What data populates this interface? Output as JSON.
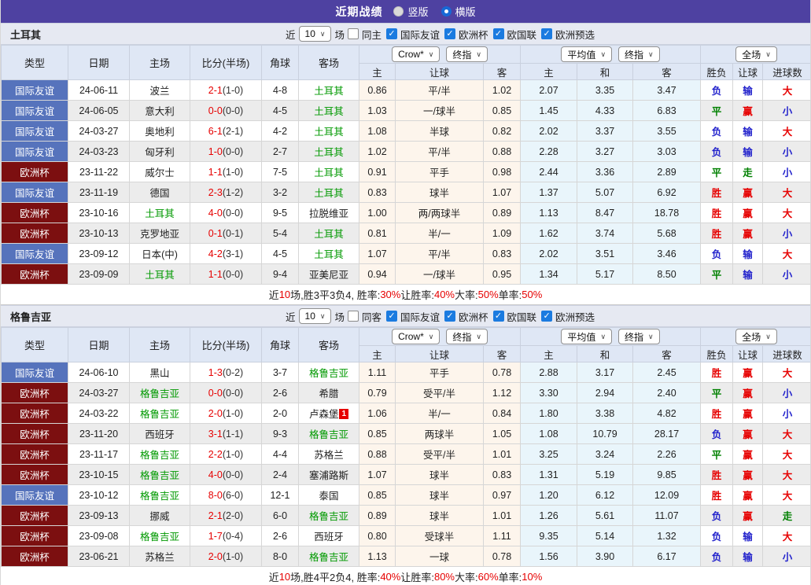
{
  "topbar": {
    "title": "近期战绩",
    "vertical": "竖版",
    "horizontal": "横版",
    "selected": "横版"
  },
  "filters": {
    "near": "近",
    "count": "10",
    "games": "场",
    "leagues": [
      "国际友谊",
      "欧洲杯",
      "欧国联",
      "欧洲预选"
    ]
  },
  "table_head": {
    "left": [
      "类型",
      "日期",
      "主场",
      "比分(半场)",
      "角球",
      "客场"
    ],
    "crow_select": "Crow*",
    "final_select": "终指",
    "avg_select": "平均值",
    "full_select": "全场",
    "crow_cols": [
      "主",
      "让球",
      "客"
    ],
    "avg_cols": [
      "主",
      "和",
      "客"
    ],
    "full_cols": [
      "胜负",
      "让球",
      "进球数"
    ]
  },
  "colors": {
    "accent_purple": "#4e41a1",
    "win_red": "#e60000",
    "lose_blue": "#2323cc",
    "draw_green": "#008000",
    "team_green": "#009900",
    "friendly_blue": "#5673bc",
    "eurocup_maroon": "#7c0f10",
    "crow_bg": "#fdf5ec",
    "avg_bg": "#e9f5fb"
  },
  "sections": [
    {
      "team": "土耳其",
      "same_label": "同主",
      "rows": [
        {
          "type": "国际友谊",
          "type_color": "blue",
          "date": "24-06-11",
          "home": "波兰",
          "home_highlight": false,
          "score": "2-1",
          "half": "(1-0)",
          "corner": "4-8",
          "away": "土耳其",
          "away_highlight": true,
          "crow_home": "0.86",
          "handicap": "平/半",
          "crow_away": "1.02",
          "avg_home": "2.07",
          "avg_draw": "3.35",
          "avg_away": "3.47",
          "result": "负",
          "result_color": "blue",
          "let_result": "输",
          "let_color": "blue",
          "goal": "大",
          "goal_color": "red"
        },
        {
          "type": "国际友谊",
          "type_color": "blue",
          "date": "24-06-05",
          "home": "意大利",
          "home_highlight": false,
          "score": "0-0",
          "half": "(0-0)",
          "corner": "4-5",
          "away": "土耳其",
          "away_highlight": true,
          "crow_home": "1.03",
          "handicap": "一/球半",
          "crow_away": "0.85",
          "avg_home": "1.45",
          "avg_draw": "4.33",
          "avg_away": "6.83",
          "result": "平",
          "result_color": "green",
          "let_result": "赢",
          "let_color": "red",
          "goal": "小",
          "goal_color": "blue"
        },
        {
          "type": "国际友谊",
          "type_color": "blue",
          "date": "24-03-27",
          "home": "奥地利",
          "home_highlight": false,
          "score": "6-1",
          "half": "(2-1)",
          "corner": "4-2",
          "away": "土耳其",
          "away_highlight": true,
          "crow_home": "1.08",
          "handicap": "半球",
          "crow_away": "0.82",
          "avg_home": "2.02",
          "avg_draw": "3.37",
          "avg_away": "3.55",
          "result": "负",
          "result_color": "blue",
          "let_result": "输",
          "let_color": "blue",
          "goal": "大",
          "goal_color": "red"
        },
        {
          "type": "国际友谊",
          "type_color": "blue",
          "date": "24-03-23",
          "home": "匈牙利",
          "home_highlight": false,
          "score": "1-0",
          "half": "(0-0)",
          "corner": "2-7",
          "away": "土耳其",
          "away_highlight": true,
          "crow_home": "1.02",
          "handicap": "平/半",
          "crow_away": "0.88",
          "avg_home": "2.28",
          "avg_draw": "3.27",
          "avg_away": "3.03",
          "result": "负",
          "result_color": "blue",
          "let_result": "输",
          "let_color": "blue",
          "goal": "小",
          "goal_color": "blue"
        },
        {
          "type": "欧洲杯",
          "type_color": "maroon",
          "date": "23-11-22",
          "home": "威尔士",
          "home_highlight": false,
          "score": "1-1",
          "half": "(1-0)",
          "corner": "7-5",
          "away": "土耳其",
          "away_highlight": true,
          "crow_home": "0.91",
          "handicap": "平手",
          "crow_away": "0.98",
          "avg_home": "2.44",
          "avg_draw": "3.36",
          "avg_away": "2.89",
          "result": "平",
          "result_color": "green",
          "let_result": "走",
          "let_color": "green",
          "goal": "小",
          "goal_color": "blue"
        },
        {
          "type": "国际友谊",
          "type_color": "blue",
          "date": "23-11-19",
          "home": "德国",
          "home_highlight": false,
          "score": "2-3",
          "half": "(1-2)",
          "corner": "3-2",
          "away": "土耳其",
          "away_highlight": true,
          "crow_home": "0.83",
          "handicap": "球半",
          "crow_away": "1.07",
          "avg_home": "1.37",
          "avg_draw": "5.07",
          "avg_away": "6.92",
          "result": "胜",
          "result_color": "red",
          "let_result": "赢",
          "let_color": "red",
          "goal": "大",
          "goal_color": "red"
        },
        {
          "type": "欧洲杯",
          "type_color": "maroon",
          "date": "23-10-16",
          "home": "土耳其",
          "home_highlight": true,
          "score": "4-0",
          "half": "(0-0)",
          "corner": "9-5",
          "away": "拉脱维亚",
          "away_highlight": false,
          "crow_home": "1.00",
          "handicap": "两/两球半",
          "crow_away": "0.89",
          "avg_home": "1.13",
          "avg_draw": "8.47",
          "avg_away": "18.78",
          "result": "胜",
          "result_color": "red",
          "let_result": "赢",
          "let_color": "red",
          "goal": "大",
          "goal_color": "red"
        },
        {
          "type": "欧洲杯",
          "type_color": "maroon",
          "date": "23-10-13",
          "home": "克罗地亚",
          "home_highlight": false,
          "score": "0-1",
          "half": "(0-1)",
          "corner": "5-4",
          "away": "土耳其",
          "away_highlight": true,
          "crow_home": "0.81",
          "handicap": "半/一",
          "crow_away": "1.09",
          "avg_home": "1.62",
          "avg_draw": "3.74",
          "avg_away": "5.68",
          "result": "胜",
          "result_color": "red",
          "let_result": "赢",
          "let_color": "red",
          "goal": "小",
          "goal_color": "blue"
        },
        {
          "type": "国际友谊",
          "type_color": "blue",
          "date": "23-09-12",
          "home": "日本(中)",
          "home_highlight": false,
          "score": "4-2",
          "half": "(3-1)",
          "corner": "4-5",
          "away": "土耳其",
          "away_highlight": true,
          "crow_home": "1.07",
          "handicap": "平/半",
          "crow_away": "0.83",
          "avg_home": "2.02",
          "avg_draw": "3.51",
          "avg_away": "3.46",
          "result": "负",
          "result_color": "blue",
          "let_result": "输",
          "let_color": "blue",
          "goal": "大",
          "goal_color": "red"
        },
        {
          "type": "欧洲杯",
          "type_color": "maroon",
          "date": "23-09-09",
          "home": "土耳其",
          "home_highlight": true,
          "score": "1-1",
          "half": "(0-0)",
          "corner": "9-4",
          "away": "亚美尼亚",
          "away_highlight": false,
          "crow_home": "0.94",
          "handicap": "一/球半",
          "crow_away": "0.95",
          "avg_home": "1.34",
          "avg_draw": "5.17",
          "avg_away": "8.50",
          "result": "平",
          "result_color": "green",
          "let_result": "输",
          "let_color": "blue",
          "goal": "小",
          "goal_color": "blue"
        }
      ],
      "summary": [
        {
          "text": "近"
        },
        {
          "text": "10",
          "red": true
        },
        {
          "text": "场,胜3平3负4, 胜率:"
        },
        {
          "text": "30%",
          "red": true
        },
        {
          "text": " 让胜率:"
        },
        {
          "text": "40%",
          "red": true
        },
        {
          "text": " 大率:"
        },
        {
          "text": "50%",
          "red": true
        },
        {
          "text": " 单率:"
        },
        {
          "text": "50%",
          "red": true
        }
      ]
    },
    {
      "team": "格鲁吉亚",
      "same_label": "同客",
      "rows": [
        {
          "type": "国际友谊",
          "type_color": "blue",
          "date": "24-06-10",
          "home": "黑山",
          "home_highlight": false,
          "score": "1-3",
          "half": "(0-2)",
          "corner": "3-7",
          "away": "格鲁吉亚",
          "away_highlight": true,
          "crow_home": "1.11",
          "handicap": "平手",
          "crow_away": "0.78",
          "avg_home": "2.88",
          "avg_draw": "3.17",
          "avg_away": "2.45",
          "result": "胜",
          "result_color": "red",
          "let_result": "赢",
          "let_color": "red",
          "goal": "大",
          "goal_color": "red"
        },
        {
          "type": "欧洲杯",
          "type_color": "maroon",
          "date": "24-03-27",
          "home": "格鲁吉亚",
          "home_highlight": true,
          "score": "0-0",
          "half": "(0-0)",
          "corner": "2-6",
          "away": "希腊",
          "away_highlight": false,
          "crow_home": "0.79",
          "handicap": "受平/半",
          "crow_away": "1.12",
          "avg_home": "3.30",
          "avg_draw": "2.94",
          "avg_away": "2.40",
          "result": "平",
          "result_color": "green",
          "let_result": "赢",
          "let_color": "red",
          "goal": "小",
          "goal_color": "blue"
        },
        {
          "type": "欧洲杯",
          "type_color": "maroon",
          "date": "24-03-22",
          "home": "格鲁吉亚",
          "home_highlight": true,
          "score": "2-0",
          "half": "(1-0)",
          "corner": "2-0",
          "away": "卢森堡",
          "away_highlight": false,
          "away_badge": "1",
          "crow_home": "1.06",
          "handicap": "半/一",
          "crow_away": "0.84",
          "avg_home": "1.80",
          "avg_draw": "3.38",
          "avg_away": "4.82",
          "result": "胜",
          "result_color": "red",
          "let_result": "赢",
          "let_color": "red",
          "goal": "小",
          "goal_color": "blue"
        },
        {
          "type": "欧洲杯",
          "type_color": "maroon",
          "date": "23-11-20",
          "home": "西班牙",
          "home_highlight": false,
          "score": "3-1",
          "half": "(1-1)",
          "corner": "9-3",
          "away": "格鲁吉亚",
          "away_highlight": true,
          "crow_home": "0.85",
          "handicap": "两球半",
          "crow_away": "1.05",
          "avg_home": "1.08",
          "avg_draw": "10.79",
          "avg_away": "28.17",
          "result": "负",
          "result_color": "blue",
          "let_result": "赢",
          "let_color": "red",
          "goal": "大",
          "goal_color": "red"
        },
        {
          "type": "欧洲杯",
          "type_color": "maroon",
          "date": "23-11-17",
          "home": "格鲁吉亚",
          "home_highlight": true,
          "score": "2-2",
          "half": "(1-0)",
          "corner": "4-4",
          "away": "苏格兰",
          "away_highlight": false,
          "crow_home": "0.88",
          "handicap": "受平/半",
          "crow_away": "1.01",
          "avg_home": "3.25",
          "avg_draw": "3.24",
          "avg_away": "2.26",
          "result": "平",
          "result_color": "green",
          "let_result": "赢",
          "let_color": "red",
          "goal": "大",
          "goal_color": "red"
        },
        {
          "type": "欧洲杯",
          "type_color": "maroon",
          "date": "23-10-15",
          "home": "格鲁吉亚",
          "home_highlight": true,
          "score": "4-0",
          "half": "(0-0)",
          "corner": "2-4",
          "away": "塞浦路斯",
          "away_highlight": false,
          "crow_home": "1.07",
          "handicap": "球半",
          "crow_away": "0.83",
          "avg_home": "1.31",
          "avg_draw": "5.19",
          "avg_away": "9.85",
          "result": "胜",
          "result_color": "red",
          "let_result": "赢",
          "let_color": "red",
          "goal": "大",
          "goal_color": "red"
        },
        {
          "type": "国际友谊",
          "type_color": "blue",
          "date": "23-10-12",
          "home": "格鲁吉亚",
          "home_highlight": true,
          "score": "8-0",
          "half": "(6-0)",
          "corner": "12-1",
          "away": "泰国",
          "away_highlight": false,
          "crow_home": "0.85",
          "handicap": "球半",
          "crow_away": "0.97",
          "avg_home": "1.20",
          "avg_draw": "6.12",
          "avg_away": "12.09",
          "result": "胜",
          "result_color": "red",
          "let_result": "赢",
          "let_color": "red",
          "goal": "大",
          "goal_color": "red"
        },
        {
          "type": "欧洲杯",
          "type_color": "maroon",
          "date": "23-09-13",
          "home": "挪威",
          "home_highlight": false,
          "score": "2-1",
          "half": "(2-0)",
          "corner": "6-0",
          "away": "格鲁吉亚",
          "away_highlight": true,
          "crow_home": "0.89",
          "handicap": "球半",
          "crow_away": "1.01",
          "avg_home": "1.26",
          "avg_draw": "5.61",
          "avg_away": "11.07",
          "result": "负",
          "result_color": "blue",
          "let_result": "赢",
          "let_color": "red",
          "goal": "走",
          "goal_color": "green"
        },
        {
          "type": "欧洲杯",
          "type_color": "maroon",
          "date": "23-09-08",
          "home": "格鲁吉亚",
          "home_highlight": true,
          "score": "1-7",
          "half": "(0-4)",
          "corner": "2-6",
          "away": "西班牙",
          "away_highlight": false,
          "crow_home": "0.80",
          "handicap": "受球半",
          "crow_away": "1.11",
          "avg_home": "9.35",
          "avg_draw": "5.14",
          "avg_away": "1.32",
          "result": "负",
          "result_color": "blue",
          "let_result": "输",
          "let_color": "blue",
          "goal": "大",
          "goal_color": "red"
        },
        {
          "type": "欧洲杯",
          "type_color": "maroon",
          "date": "23-06-21",
          "home": "苏格兰",
          "home_highlight": false,
          "score": "2-0",
          "half": "(1-0)",
          "corner": "8-0",
          "away": "格鲁吉亚",
          "away_highlight": true,
          "crow_home": "1.13",
          "handicap": "一球",
          "crow_away": "0.78",
          "avg_home": "1.56",
          "avg_draw": "3.90",
          "avg_away": "6.17",
          "result": "负",
          "result_color": "blue",
          "let_result": "输",
          "let_color": "blue",
          "goal": "小",
          "goal_color": "blue"
        }
      ],
      "summary": [
        {
          "text": "近"
        },
        {
          "text": "10",
          "red": true
        },
        {
          "text": "场,胜4平2负4, 胜率:"
        },
        {
          "text": "40%",
          "red": true
        },
        {
          "text": " 让胜率:"
        },
        {
          "text": "80%",
          "red": true
        },
        {
          "text": " 大率:"
        },
        {
          "text": "60%",
          "red": true
        },
        {
          "text": " 单率:"
        },
        {
          "text": "10%",
          "red": true
        }
      ]
    }
  ]
}
